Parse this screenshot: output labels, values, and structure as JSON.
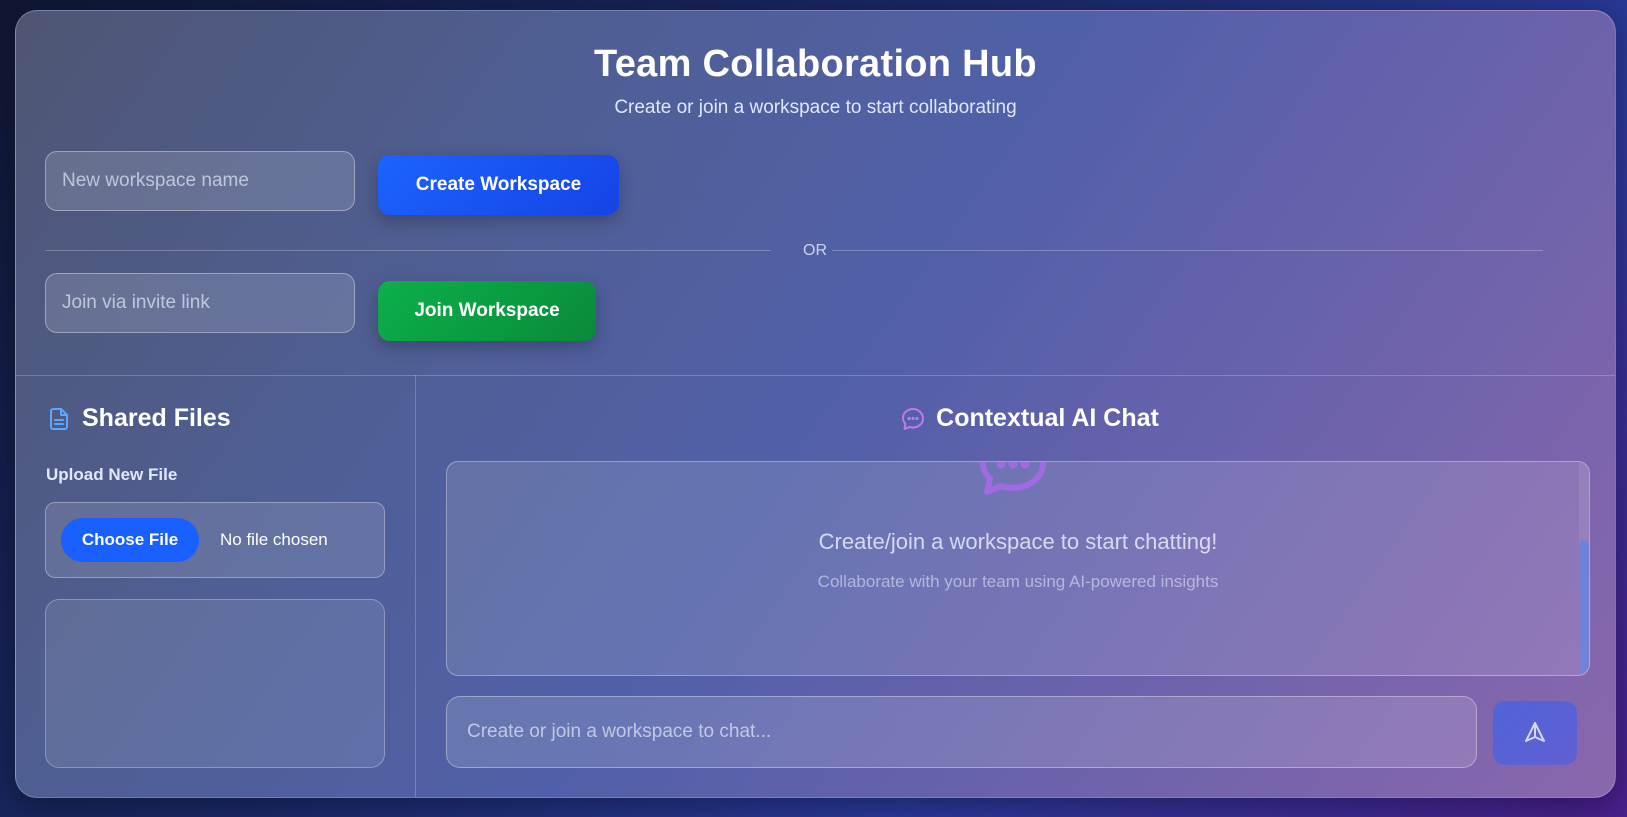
{
  "header": {
    "title": "Team Collaboration Hub",
    "subtitle": "Create or join a workspace to start collaborating"
  },
  "workspace": {
    "create_placeholder": "New workspace name",
    "create_button": "Create Workspace",
    "divider_text": "OR",
    "join_placeholder": "Join via invite link",
    "join_button": "Join Workspace"
  },
  "files": {
    "title": "Shared Files",
    "icon": "document-icon",
    "upload_label": "Upload New File",
    "choose_button": "Choose File",
    "no_file_text": "No file chosen"
  },
  "chat": {
    "title": "Contextual AI Chat",
    "icon": "chat-bubble-icon",
    "empty_title": "Create/join a workspace to start chatting!",
    "empty_subtitle": "Collaborate with your team using AI-powered insights",
    "input_placeholder": "Create or join a workspace to chat...",
    "send_icon": "send-icon"
  },
  "colors": {
    "create_button": "#1c63ff",
    "join_button": "#0bb04a",
    "choose_button": "#1a5fff",
    "accent_purple": "#a877e8"
  }
}
